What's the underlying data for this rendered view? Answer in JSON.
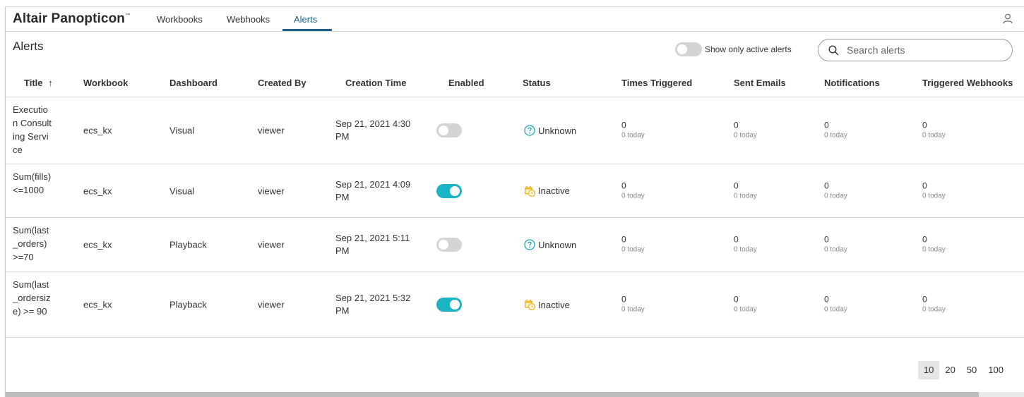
{
  "app": {
    "brand": "Altair Panopticon",
    "brand_mark": "™"
  },
  "nav": {
    "tabs": [
      {
        "label": "Workbooks"
      },
      {
        "label": "Webhooks"
      },
      {
        "label": "Alerts"
      }
    ],
    "active_tab": "Alerts",
    "user_icon": "user-icon"
  },
  "page": {
    "title": "Alerts"
  },
  "filter": {
    "label": "Show only active alerts",
    "enabled": false
  },
  "search": {
    "placeholder": "Search alerts",
    "value": "",
    "icon": "search-icon"
  },
  "table": {
    "columns": [
      {
        "label": "Title",
        "sort": "↑"
      },
      {
        "label": "Workbook"
      },
      {
        "label": "Dashboard"
      },
      {
        "label": "Created By"
      },
      {
        "label": "Creation Time"
      },
      {
        "label": "Enabled"
      },
      {
        "label": "Status"
      },
      {
        "label": "Times Triggered"
      },
      {
        "label": "Sent Emails"
      },
      {
        "label": "Notifications"
      },
      {
        "label": "Triggered Webhooks"
      }
    ],
    "rows": [
      {
        "title": "Execution Consulting Service",
        "workbook": "ecs_kx",
        "dashboard": "Visual",
        "created_by": "viewer",
        "creation_time": "Sep 21, 2021 4:30 PM",
        "enabled": false,
        "status": "Unknown",
        "status_icon": "question-circle-icon",
        "times_triggered": "0",
        "times_triggered_today": "0 today",
        "sent_emails": "0",
        "sent_emails_today": "0 today",
        "notifications": "0",
        "notifications_today": "0 today",
        "triggered_webhooks": "0",
        "triggered_webhooks_today": "0 today"
      },
      {
        "title": "Sum(fills) <=1000",
        "workbook": "ecs_kx",
        "dashboard": "Visual",
        "created_by": "viewer",
        "creation_time": "Sep 21, 2021 4:09 PM",
        "enabled": true,
        "status": "Inactive",
        "status_icon": "calendar-clock-icon",
        "times_triggered": "0",
        "times_triggered_today": "0 today",
        "sent_emails": "0",
        "sent_emails_today": "0 today",
        "notifications": "0",
        "notifications_today": "0 today",
        "triggered_webhooks": "0",
        "triggered_webhooks_today": "0 today"
      },
      {
        "title": "Sum(last_orders) >=70",
        "workbook": "ecs_kx",
        "dashboard": "Playback",
        "created_by": "viewer",
        "creation_time": "Sep 21, 2021 5:11 PM",
        "enabled": false,
        "status": "Unknown",
        "status_icon": "question-circle-icon",
        "times_triggered": "0",
        "times_triggered_today": "0 today",
        "sent_emails": "0",
        "sent_emails_today": "0 today",
        "notifications": "0",
        "notifications_today": "0 today",
        "triggered_webhooks": "0",
        "triggered_webhooks_today": "0 today"
      },
      {
        "title": "Sum(last_ordersize) >= 90",
        "workbook": "ecs_kx",
        "dashboard": "Playback",
        "created_by": "viewer",
        "creation_time": "Sep 21, 2021 5:32 PM",
        "enabled": true,
        "status": "Inactive",
        "status_icon": "calendar-clock-icon",
        "times_triggered": "0",
        "times_triggered_today": "0 today",
        "sent_emails": "0",
        "sent_emails_today": "0 today",
        "notifications": "0",
        "notifications_today": "0 today",
        "triggered_webhooks": "0",
        "triggered_webhooks_today": "0 today"
      }
    ]
  },
  "pagination": {
    "sizes": [
      "10",
      "20",
      "50",
      "100"
    ],
    "selected": "10"
  },
  "colors": {
    "accent": "#1f5f8b",
    "toggle_on": "#1bb4c4",
    "inactive_icon": "#f5b81c",
    "unknown_icon": "#1ba6b8"
  }
}
